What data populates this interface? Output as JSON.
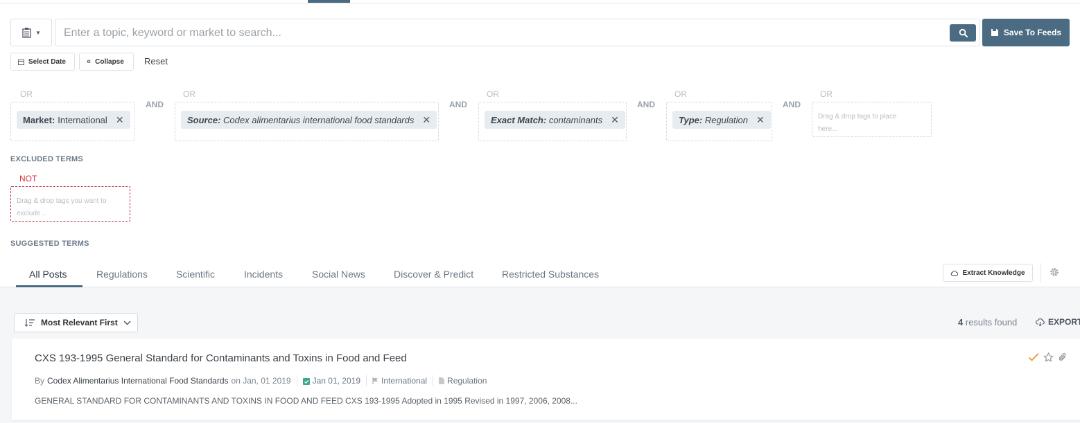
{
  "search": {
    "placeholder": "Enter a topic, keyword or market to search...",
    "save_label": "Save To Feeds"
  },
  "filters": {
    "select_date": "Select Date",
    "collapse": "Collapse",
    "reset": "Reset"
  },
  "groups": [
    {
      "operator": "OR",
      "tag": {
        "key": "Market:",
        "value": "International"
      }
    },
    {
      "operator": "OR",
      "tag": {
        "key": "Source:",
        "value": "Codex alimentarius international food standards"
      }
    },
    {
      "operator": "OR",
      "tag": {
        "key": "Exact Match:",
        "value": "contaminants"
      }
    },
    {
      "operator": "OR",
      "tag": {
        "key": "Type:",
        "value": "Regulation"
      }
    },
    {
      "operator": "OR",
      "placeholder_line1": "Drag & drop tags to place",
      "placeholder_line2": "here..."
    }
  ],
  "and_label": "AND",
  "excluded": {
    "title": "EXCLUDED TERMS",
    "not_label": "NOT",
    "placeholder_line1": "Drag & drop tags you want to",
    "placeholder_line2": "exclude..."
  },
  "suggested_title": "SUGGESTED TERMS",
  "tabs": [
    {
      "label": "All Posts"
    },
    {
      "label": "Regulations"
    },
    {
      "label": "Scientific"
    },
    {
      "label": "Incidents"
    },
    {
      "label": "Social News"
    },
    {
      "label": "Discover & Predict"
    },
    {
      "label": "Restricted Substances"
    }
  ],
  "extract_label": "Extract Knowledge",
  "results": {
    "sort_label": "Most Relevant First",
    "count": "4",
    "count_suffix": "results found",
    "export_label": "EXPORT"
  },
  "post": {
    "title": "CXS 193-1995 General Standard for Contaminants and Toxins in Food and Feed",
    "by": "By",
    "author": "Codex Alimentarius International Food Standards",
    "on_date": "on Jan, 01 2019",
    "date_chip": "Jan 01, 2019",
    "market_chip": "International",
    "type_chip": "Regulation",
    "excerpt": "GENERAL STANDARD FOR CONTAMINANTS AND TOXINS IN FOOD AND FEED CXS 193-1995 Adopted in 1995 Revised in 1997, 2006, 2008..."
  },
  "colors": {
    "primary": "#4a6b82",
    "not": "#d9323b",
    "check": "#f0a04b",
    "date_icon": "#3aaa8c"
  }
}
